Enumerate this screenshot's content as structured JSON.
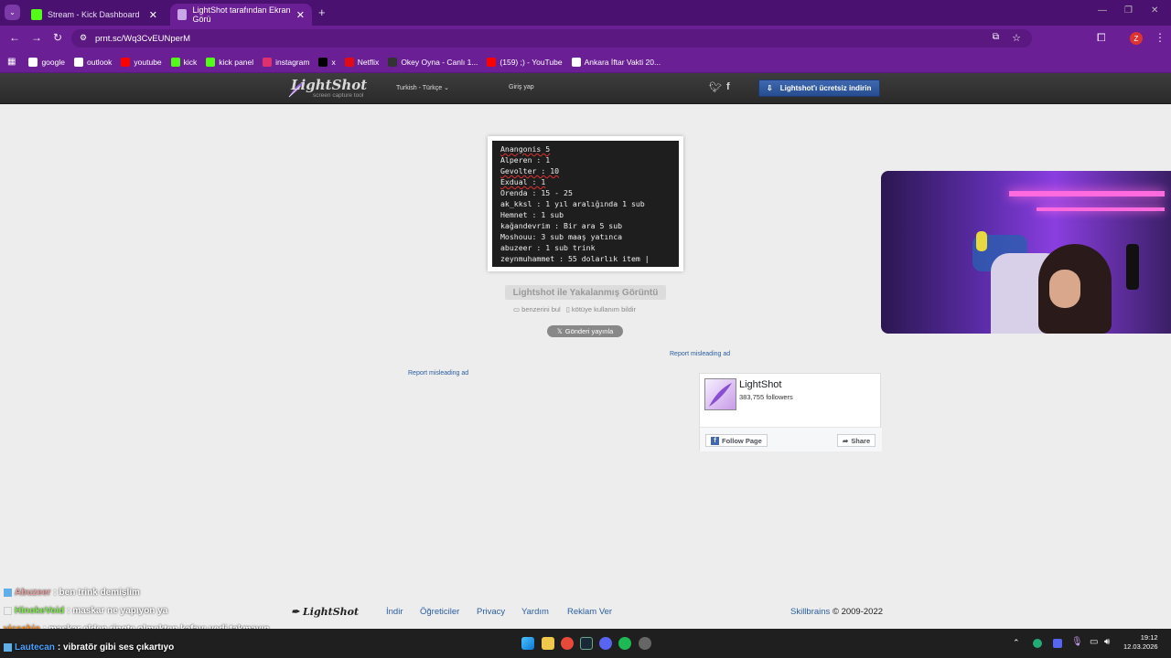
{
  "browser": {
    "tabs": [
      {
        "title": "Stream - Kick Dashboard"
      },
      {
        "title": "LightShot tarafından Ekran Görü"
      }
    ],
    "new_tab_glyph": "+",
    "url": "prnt.sc/Wq3CvEUNperM",
    "profile_letter": "Z",
    "bookmarks": [
      {
        "label": "google",
        "icon": "google-icon",
        "color": "#ffffff"
      },
      {
        "label": "outlook",
        "icon": "outlook-icon",
        "color": "#ffffff"
      },
      {
        "label": "youtube",
        "icon": "youtube-icon",
        "color": "#ff0000"
      },
      {
        "label": "kick",
        "icon": "kick-icon",
        "color": "#53fc18"
      },
      {
        "label": "kick panel",
        "icon": "kick-icon",
        "color": "#53fc18"
      },
      {
        "label": "instagram",
        "icon": "instagram-icon",
        "color": "#e1306c"
      },
      {
        "label": "x",
        "icon": "x-icon",
        "color": "#000000"
      },
      {
        "label": "Netflix",
        "icon": "netflix-icon",
        "color": "#e50914"
      },
      {
        "label": "Okey Oyna - Canlı 1...",
        "icon": "okey-icon",
        "color": "#333333"
      },
      {
        "label": "(159) ;) - YouTube",
        "icon": "youtube-icon",
        "color": "#ff0000"
      },
      {
        "label": "Ankara İftar Vakti 20...",
        "icon": "site-icon",
        "color": "#ffffff"
      }
    ]
  },
  "lightshot": {
    "logo": "LightShot",
    "logo_sub": "screen capture tool",
    "language": "Turkish - Türkçe",
    "login": "Giriş yap",
    "download_btn": "Lightshot'ı ücretsiz indirin",
    "screenshot_lines": [
      "Anangonis 5",
      "Alperen : 1",
      "Gevolter : 10",
      "Exdual : 1",
      "Orenda : 15 - 25",
      "ak_kksl : 1 yıl aralığında 1 sub",
      "Hemnet : 1 sub",
      "kağandevrim : Bir ara 5 sub",
      "Moshouu: 3 sub maaş yatınca",
      "abuzeer : 1 sub trink",
      "zeynmuhammet : 55 dolarlık item |"
    ],
    "caption": "Lightshot ile Yakalanmış Görüntü",
    "similar": "benzerini bul",
    "report_abuse": "kötüye kullanım bildir",
    "tweet": "Gönderi yayınla",
    "report_ad_1": "Report misleading ad",
    "report_ad_2": "Report misleading ad",
    "fb": {
      "name": "LightShot",
      "followers": "383,755 followers",
      "follow": "Follow Page",
      "share": "Share"
    },
    "footer": {
      "logo": "LightShot",
      "links": [
        "İndir",
        "Öğreticiler",
        "Privacy",
        "Yardım",
        "Reklam Ver"
      ],
      "company": "Skillbrains",
      "copyright": "© 2009-2022"
    }
  },
  "chat": [
    {
      "user": "Abuzeer",
      "msg": ": ben trink demişlim",
      "color": "#e8a0a0"
    },
    {
      "user": "HinokeVoid",
      "msg": ": maskar ne yapıyon ya",
      "color": "#7ee84a"
    },
    {
      "user": "vicsebio",
      "msg": ": maskar elden ringte olmekten kafayı yedi takmayın",
      "color": "#ff8c1a"
    },
    {
      "user": "Lautecan",
      "msg": ": vibratör gibi ses çıkartıyo",
      "color": "#4aa3ff"
    }
  ],
  "taskbar": {
    "time": "19:12",
    "date": "12.03.2026"
  }
}
